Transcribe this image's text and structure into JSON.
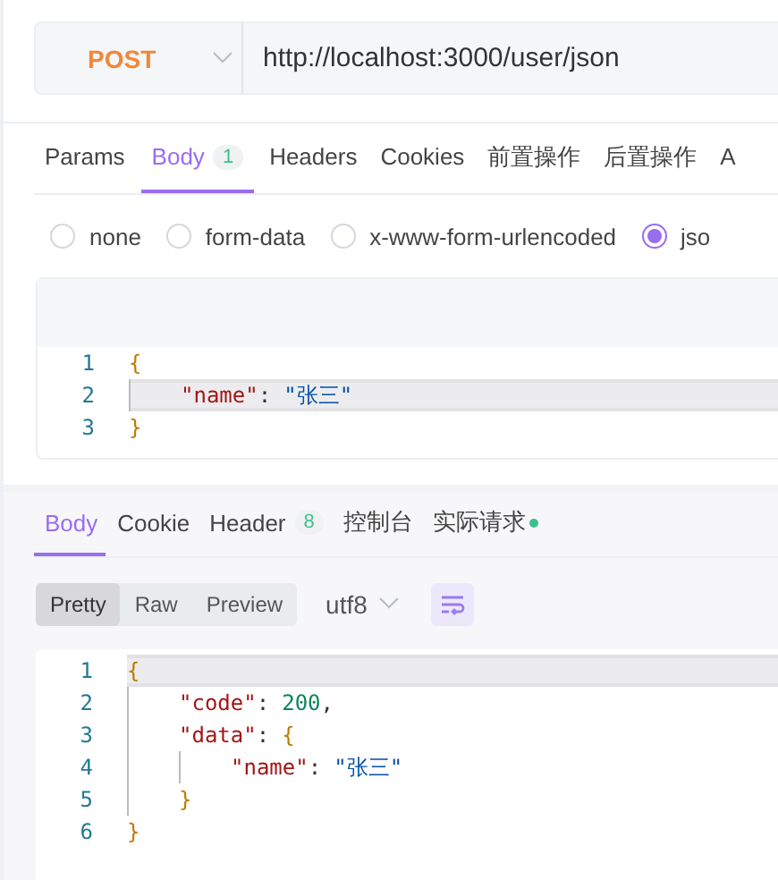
{
  "request": {
    "method": "POST",
    "url": "http://localhost:3000/user/json"
  },
  "request_tabs": [
    {
      "label": "Params",
      "selected": false
    },
    {
      "label": "Body",
      "badge": "1",
      "selected": true
    },
    {
      "label": "Headers",
      "selected": false
    },
    {
      "label": "Cookies",
      "selected": false
    },
    {
      "label": "前置操作",
      "selected": false
    },
    {
      "label": "后置操作",
      "selected": false
    },
    {
      "label": "A",
      "selected": false
    }
  ],
  "body_types": [
    {
      "label": "none",
      "selected": false
    },
    {
      "label": "form-data",
      "selected": false
    },
    {
      "label": "x-www-form-urlencoded",
      "selected": false
    },
    {
      "label": "jso",
      "selected": true
    }
  ],
  "request_body": [
    {
      "number": "1",
      "current": false,
      "tokens": [
        {
          "kind": "bracket",
          "text": "{"
        }
      ]
    },
    {
      "number": "2",
      "current": true,
      "tokens": [
        {
          "kind": "key",
          "text": "\"name\""
        },
        {
          "kind": "punct",
          "text": ":"
        },
        {
          "kind": "string",
          "text": "\"张三\""
        }
      ]
    },
    {
      "number": "3",
      "current": false,
      "tokens": [
        {
          "kind": "bracket",
          "text": "}"
        }
      ]
    }
  ],
  "response_tabs": [
    {
      "label": "Body",
      "selected": true
    },
    {
      "label": "Cookie",
      "selected": false
    },
    {
      "label": "Header",
      "badge": "8",
      "selected": false
    },
    {
      "label": "控制台",
      "selected": false
    },
    {
      "label": "实际请求",
      "color": "#3cc18c",
      "selected": false
    }
  ],
  "view_modes": [
    {
      "label": "Pretty",
      "selected": true
    },
    {
      "label": "Raw",
      "selected": false
    },
    {
      "label": "Preview",
      "selected": false
    }
  ],
  "encoding": "utf8",
  "response_body": [
    {
      "number": "1",
      "current": true,
      "tokens": [
        {
          "kind": "bracket",
          "text": "{"
        }
      ]
    },
    {
      "number": "2",
      "current": false,
      "tokens": [
        {
          "kind": "key",
          "text": "\"code\""
        },
        {
          "kind": "punct",
          "text": ":"
        },
        {
          "kind": "number",
          "text": "200"
        },
        {
          "kind": "comma",
          "text": ","
        }
      ]
    },
    {
      "number": "3",
      "current": false,
      "tokens": [
        {
          "kind": "key",
          "text": "\"data\""
        },
        {
          "kind": "punct",
          "text": ":"
        },
        {
          "kind": "bracket",
          "text": "{"
        }
      ]
    },
    {
      "number": "4",
      "current": false,
      "tokens": [
        {
          "kind": "key",
          "text": "\"name\""
        },
        {
          "kind": "punct",
          "text": ":"
        },
        {
          "kind": "string",
          "text": "\"张三\""
        }
      ]
    },
    {
      "number": "5",
      "current": false,
      "tokens": [
        {
          "kind": "bracket",
          "text": "}"
        }
      ]
    },
    {
      "number": "6",
      "current": false,
      "tokens": [
        {
          "kind": "bracket",
          "text": "}"
        }
      ]
    }
  ]
}
